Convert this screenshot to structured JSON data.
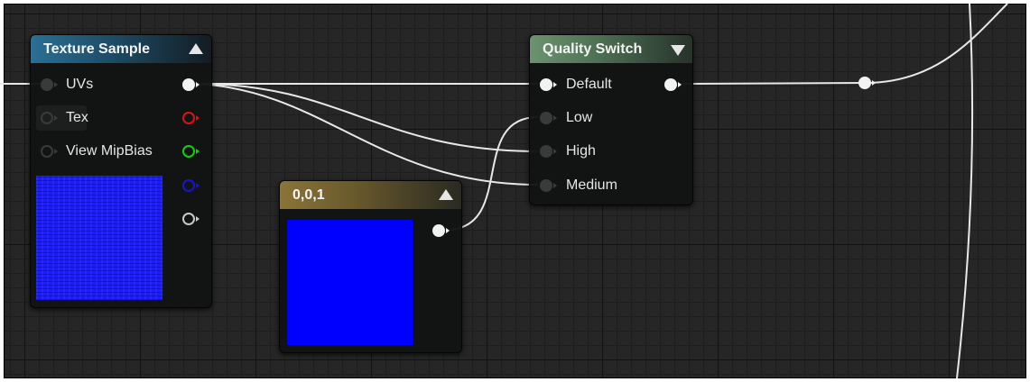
{
  "nodes": {
    "texture_sample": {
      "title": "Texture Sample",
      "inputs": [
        "UVs",
        "Tex",
        "View MipBias"
      ],
      "outputs": [
        "rgb-white",
        "r-red",
        "g-green",
        "b-blue",
        "a-gray"
      ],
      "preview_color": "#1b1bff"
    },
    "quality_switch": {
      "title": "Quality Switch",
      "inputs": [
        "Default",
        "Low",
        "High",
        "Medium"
      ]
    },
    "constant3": {
      "title": "0,0,1",
      "preview_color": "#0000ff"
    }
  },
  "colors": {
    "pin_white": "#f2f2f2",
    "pin_red": "#e01010",
    "pin_green": "#10d010",
    "pin_blue": "#1414d8",
    "pin_gray": "#c8c8c8",
    "pin_unconnected": "#3a3a3a",
    "wire": "#e8e8e8"
  }
}
